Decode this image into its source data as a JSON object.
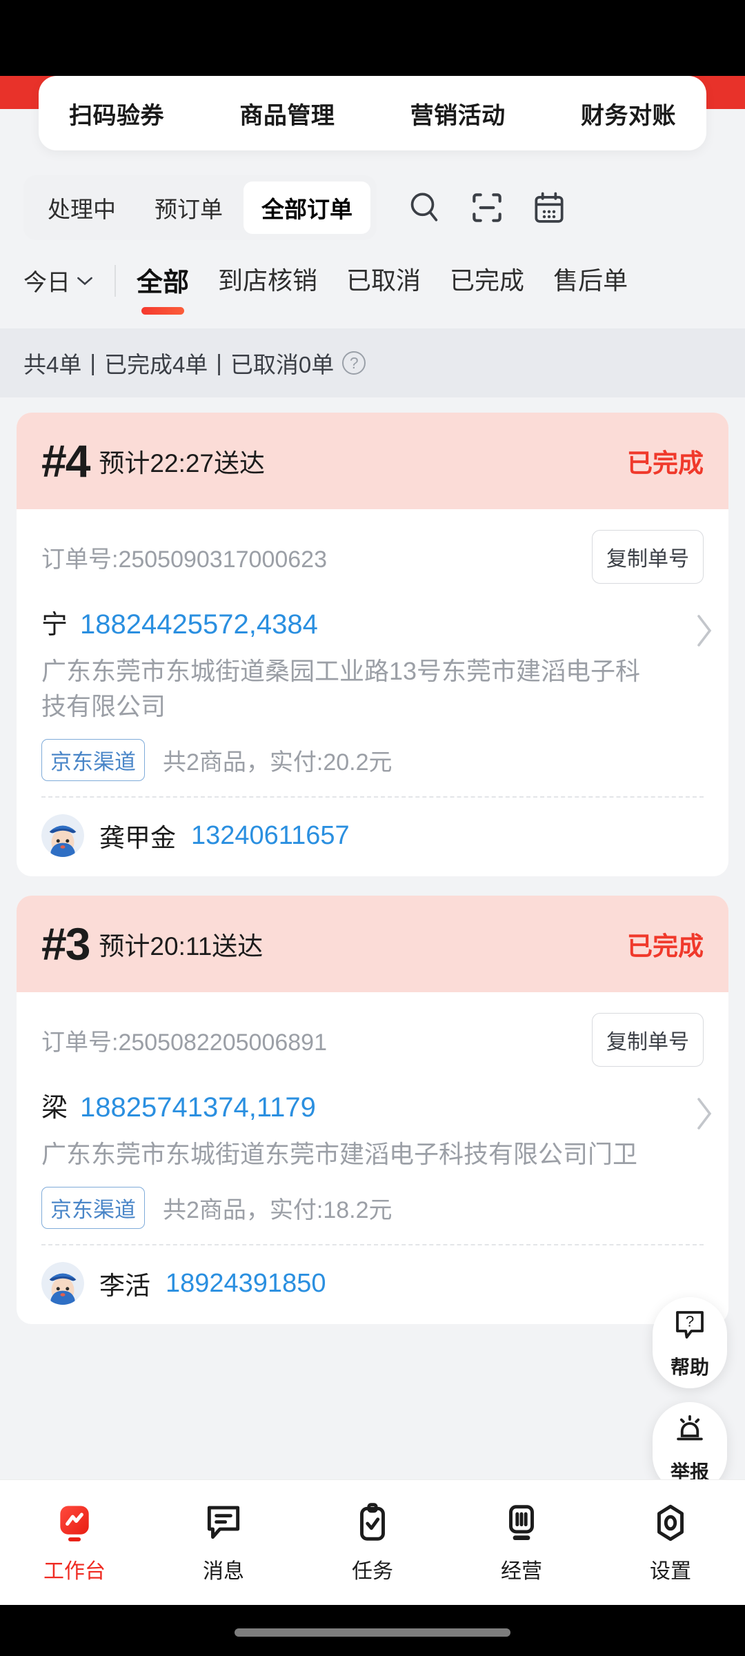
{
  "quick_actions": {
    "items": [
      {
        "label": "扫码验券"
      },
      {
        "label": "商品管理"
      },
      {
        "label": "营销活动"
      },
      {
        "label": "财务对账"
      }
    ]
  },
  "order_scope": {
    "segments": [
      {
        "label": "处理中",
        "active": false
      },
      {
        "label": "预订单",
        "active": false
      },
      {
        "label": "全部订单",
        "active": true
      }
    ],
    "icons": [
      {
        "name": "search-icon"
      },
      {
        "name": "scan-icon"
      },
      {
        "name": "calendar-icon"
      }
    ]
  },
  "filters": {
    "date_label": "今日",
    "tabs": [
      {
        "label": "全部",
        "active": true
      },
      {
        "label": "到店核销",
        "active": false
      },
      {
        "label": "已取消",
        "active": false
      },
      {
        "label": "已完成",
        "active": false
      },
      {
        "label": "售后单",
        "active": false
      }
    ]
  },
  "summary": {
    "total": "共4单",
    "sep1": "|",
    "completed": "已完成4单",
    "sep2": "|",
    "cancelled": "已取消0单",
    "help_glyph": "?"
  },
  "orders": [
    {
      "seq": "#4",
      "eta": "预计22:27送达",
      "status": "已完成",
      "order_no": "订单号:2505090317000623",
      "copy_label": "复制单号",
      "customer_name": "宁",
      "customer_phone": "18824425572,4384",
      "address": "广东东莞市东城街道桑园工业路13号东莞市建滔电子科技有限公司",
      "channel_tag": "京东渠道",
      "goods_text": "共2商品，实付:20.2元",
      "rider_name": "龚甲金",
      "rider_phone": "13240611657"
    },
    {
      "seq": "#3",
      "eta": "预计20:11送达",
      "status": "已完成",
      "order_no": "订单号:2505082205006891",
      "copy_label": "复制单号",
      "customer_name": "梁",
      "customer_phone": "18825741374,1179",
      "address": "广东东莞市东城街道东莞市建滔电子科技有限公司门卫",
      "channel_tag": "京东渠道",
      "goods_text": "共2商品，实付:18.2元",
      "rider_name": "李活",
      "rider_phone": "18924391850"
    }
  ],
  "floating_buttons": [
    {
      "label": "帮助",
      "icon": "question-bubble-icon"
    },
    {
      "label": "举报",
      "icon": "siren-icon"
    }
  ],
  "bottom_nav": {
    "items": [
      {
        "label": "工作台",
        "icon": "workbench-icon",
        "active": true
      },
      {
        "label": "消息",
        "icon": "message-icon",
        "active": false
      },
      {
        "label": "任务",
        "icon": "task-clipboard-icon",
        "active": false
      },
      {
        "label": "经营",
        "icon": "business-chart-icon",
        "active": false
      },
      {
        "label": "设置",
        "icon": "settings-icon",
        "active": false
      }
    ]
  },
  "colors": {
    "brand_red": "#ef2b22",
    "status_red": "#f0392b",
    "link_blue": "#2a8fe0",
    "card_head_pink": "#fbdcd7",
    "page_bg": "#f2f3f5"
  }
}
